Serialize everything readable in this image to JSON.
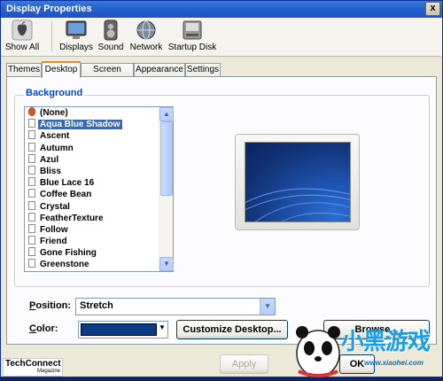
{
  "window": {
    "title": "Display Properties",
    "close_glyph": "x"
  },
  "toolbar": {
    "items": [
      {
        "label": "Show All",
        "icon": "apple-icon"
      },
      {
        "label": "Displays",
        "icon": "monitor-icon"
      },
      {
        "label": "Sound",
        "icon": "speaker-icon"
      },
      {
        "label": "Network",
        "icon": "globe-icon"
      },
      {
        "label": "Startup Disk",
        "icon": "disk-icon"
      }
    ]
  },
  "tabs": [
    {
      "label": "Themes",
      "active": false
    },
    {
      "label": "Desktop",
      "active": true
    },
    {
      "label": "Screen Saver",
      "active": false
    },
    {
      "label": "Appearance",
      "active": false
    },
    {
      "label": "Settings",
      "active": false
    }
  ],
  "background": {
    "group_label": "Background",
    "items": [
      "(None)",
      "Aqua Blue Shadow",
      "Ascent",
      "Autumn",
      "Azul",
      "Bliss",
      "Blue Lace 16",
      "Coffee Bean",
      "Crystal",
      "FeatherTexture",
      "Follow",
      "Friend",
      "Gone Fishing",
      "Greenstone"
    ],
    "selected": "Aqua Blue Shadow"
  },
  "position": {
    "label_prefix": "",
    "label_underline": "P",
    "label_rest": "osition:",
    "value": "Stretch"
  },
  "color": {
    "label_underline": "C",
    "label_rest": "olor:",
    "value": "#0a3b88"
  },
  "buttons": {
    "customize": "Customize Desktop...",
    "browse": "Browse...",
    "apply": "Apply",
    "ok": "OK"
  },
  "watermark": {
    "left_line1": "TechConnect",
    "left_line2": "Magazine",
    "right_text": "小黑游戏",
    "right_url": "www.xiaohei.com"
  },
  "colors": {
    "accent": "#0046d5",
    "titlebar": "#2662d0",
    "tab_highlight": "#e68b2c"
  }
}
